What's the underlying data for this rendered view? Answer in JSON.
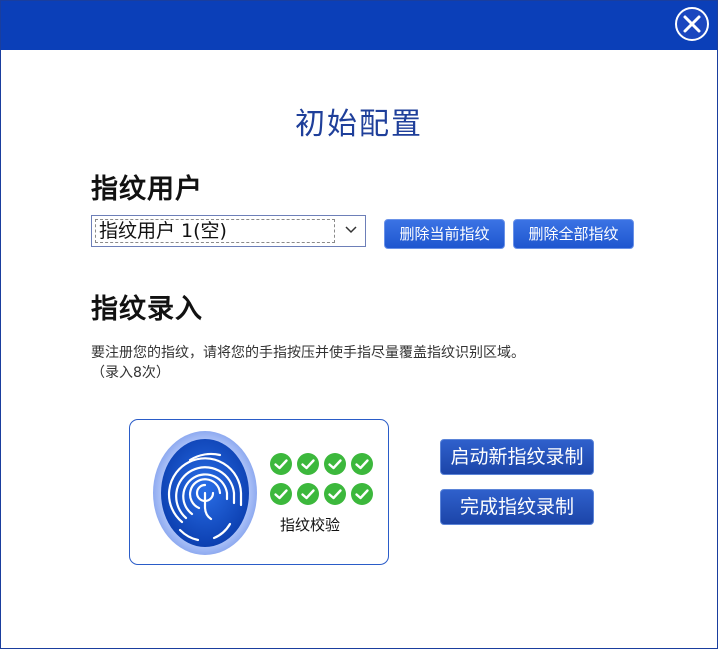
{
  "window": {
    "title": "初始配置",
    "close_icon": "close-icon"
  },
  "fingerprint_user": {
    "heading": "指纹用户",
    "selected_user": "指纹用户 1(空)",
    "delete_current_label": "删除当前指纹",
    "delete_all_label": "删除全部指纹"
  },
  "enrollment": {
    "heading": "指纹录入",
    "instruction_line1": "要注册您的指纹，请将您的手指按压并使手指尽量覆盖指纹识别区域。",
    "instruction_line2": "（录入8次）",
    "verify_label": "指纹校验",
    "checks_completed": 8,
    "checks_total": 8,
    "start_label": "启动新指纹录制",
    "finish_label": "完成指纹录制"
  },
  "colors": {
    "titlebar": "#0b3fb8",
    "accent": "#1f56cf",
    "check": "#3cb83c"
  }
}
